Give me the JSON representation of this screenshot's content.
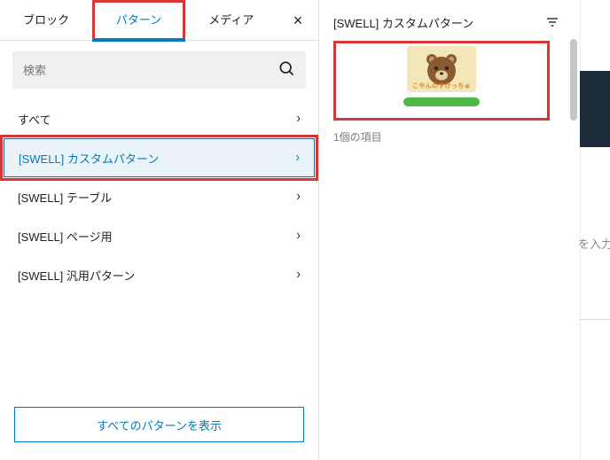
{
  "tabs": {
    "block": "ブロック",
    "pattern": "パターン",
    "media": "メディア"
  },
  "close_glyph": "×",
  "search": {
    "placeholder": "検索"
  },
  "categories": [
    {
      "label": "すべて"
    },
    {
      "label": "[SWELL] カスタムパターン"
    },
    {
      "label": "[SWELL] テーブル"
    },
    {
      "label": "[SWELL] ページ用"
    },
    {
      "label": "[SWELL] 汎用パターン"
    }
  ],
  "explore_label": "すべてのパターンを表示",
  "preview": {
    "title": "[SWELL] カスタムパターン",
    "count_label": "1個の項目",
    "card_caption": "こやんのすけっちゅ"
  },
  "bg": {
    "input_hint": "を入力"
  }
}
